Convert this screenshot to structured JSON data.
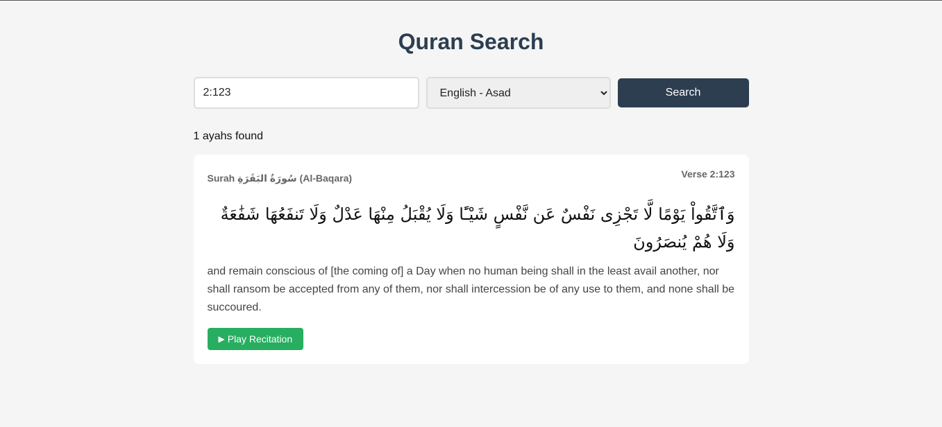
{
  "page": {
    "title": "Quran Search"
  },
  "search": {
    "query": "2:123",
    "translation_selected": "English - Asad",
    "translation_options": [
      "English - Asad"
    ],
    "button_label": "Search"
  },
  "results": {
    "count_text": "1 ayahs found",
    "ayahs": [
      {
        "surah_label": "Surah سُورَةُ البَقَرَةِ (Al-Baqara)",
        "verse_label": "Verse 2:123",
        "arabic": "وَٱتَّقُواْ يَوْمًا لَّا تَجْزِى نَفْسٌ عَن نَّفْسٍ شَيْـًٔا وَلَا يُقْبَلُ مِنْهَا عَدْلٌ وَلَا تَنفَعُهَا شَفَٰعَةٌ وَلَا هُمْ يُنصَرُونَ",
        "translation": "and remain conscious of [the coming of] a Day when no human being shall in the least avail another, nor shall ransom be accepted from any of them, nor shall intercession be of any use to them, and none shall be succoured.",
        "play_icon": "▶",
        "play_label": "Play Recitation"
      }
    ]
  },
  "colors": {
    "background": "#f5f5f5",
    "heading": "#2c3e50",
    "primary_button": "#2c3e50",
    "play_button": "#27ae60"
  }
}
